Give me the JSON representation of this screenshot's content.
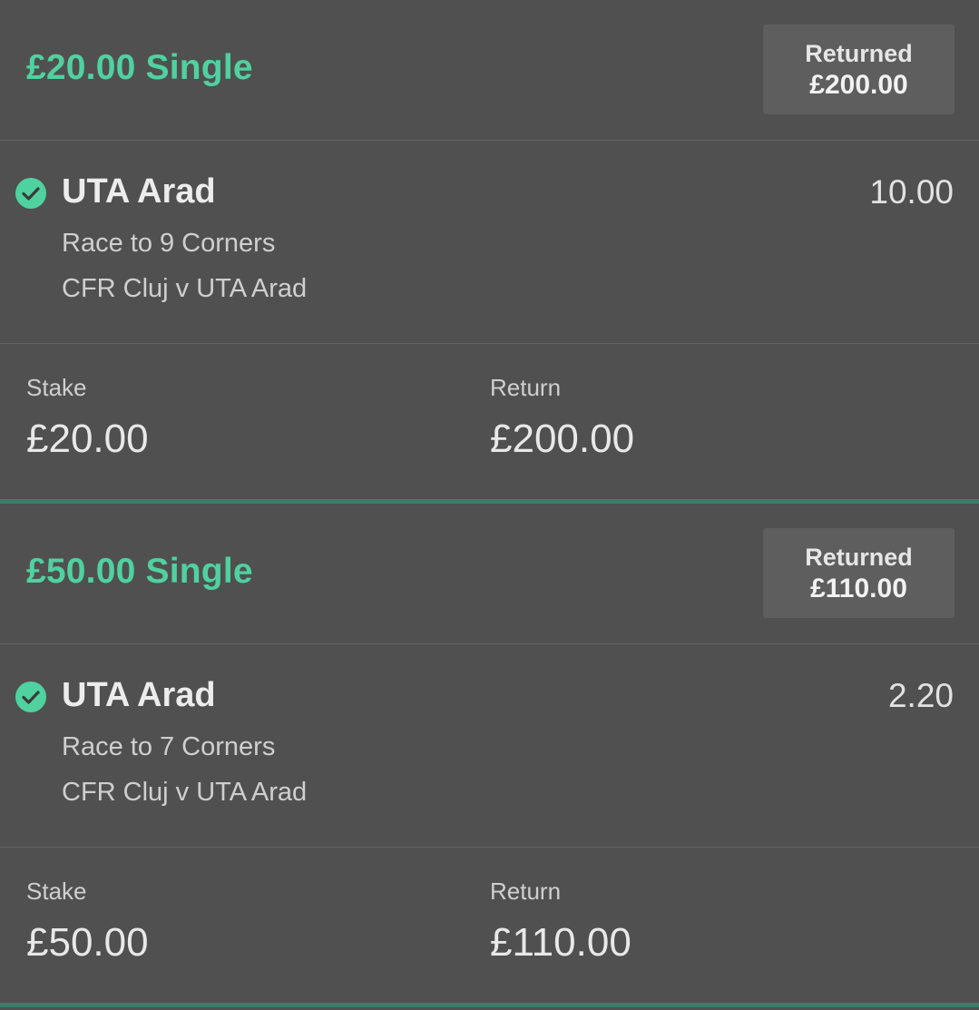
{
  "accent_color": "#4fd1a0",
  "bets": [
    {
      "title": "£20.00 Single",
      "returned_label": "Returned",
      "returned_value": "£200.00",
      "selection": {
        "status_icon": "check-circle-icon",
        "name": "UTA Arad",
        "odds": "10.00",
        "market": "Race to 9 Corners",
        "event": "CFR Cluj v UTA Arad"
      },
      "stake_label": "Stake",
      "stake_value": "£20.00",
      "return_label": "Return",
      "return_value": "£200.00"
    },
    {
      "title": "£50.00 Single",
      "returned_label": "Returned",
      "returned_value": "£110.00",
      "selection": {
        "status_icon": "check-circle-icon",
        "name": "UTA Arad",
        "odds": "2.20",
        "market": "Race to 7 Corners",
        "event": "CFR Cluj v UTA Arad"
      },
      "stake_label": "Stake",
      "stake_value": "£50.00",
      "return_label": "Return",
      "return_value": "£110.00"
    }
  ]
}
